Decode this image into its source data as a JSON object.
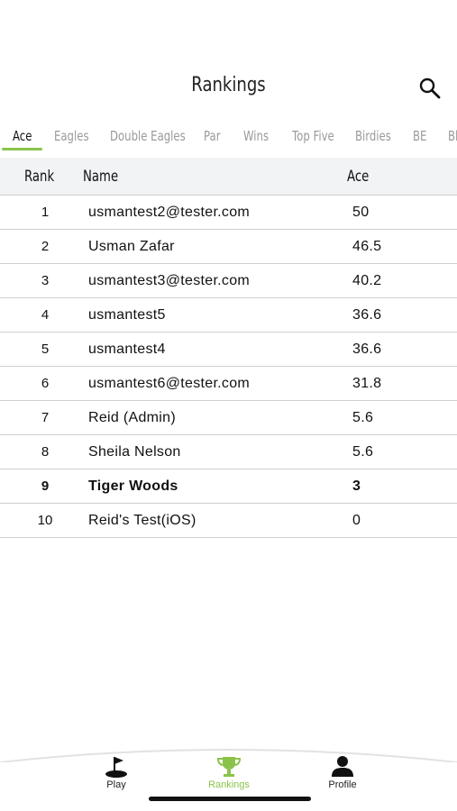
{
  "header": {
    "title": "Rankings",
    "search_icon": "search-icon"
  },
  "tabs": [
    {
      "label": "Ace",
      "active": true
    },
    {
      "label": "Eagles"
    },
    {
      "label": "Double Eagles"
    },
    {
      "label": "Par"
    },
    {
      "label": "Wins"
    },
    {
      "label": "Top Five"
    },
    {
      "label": "Birdies"
    },
    {
      "label": "BE"
    },
    {
      "label": "Bl"
    }
  ],
  "table": {
    "columns": {
      "rank": "Rank",
      "name": "Name",
      "score": "Ace"
    },
    "rows": [
      {
        "rank": "1",
        "name": "usmantest2@tester.com",
        "score": "50"
      },
      {
        "rank": "2",
        "name": "Usman Zafar",
        "score": "46.5"
      },
      {
        "rank": "3",
        "name": "usmantest3@tester.com",
        "score": "40.2"
      },
      {
        "rank": "4",
        "name": "usmantest5",
        "score": "36.6"
      },
      {
        "rank": "5",
        "name": "usmantest4",
        "score": "36.6"
      },
      {
        "rank": "6",
        "name": "usmantest6@tester.com",
        "score": "31.8"
      },
      {
        "rank": "7",
        "name": "Reid (Admin)",
        "score": "5.6"
      },
      {
        "rank": "8",
        "name": "Sheila Nelson",
        "score": "5.6"
      },
      {
        "rank": "9",
        "name": "Tiger Woods",
        "score": "3",
        "highlighted": true
      },
      {
        "rank": "10",
        "name": "Reid's Test(iOS)",
        "score": "0"
      }
    ]
  },
  "bottom_nav": {
    "items": [
      {
        "label": "Play",
        "icon": "golf-flag-icon"
      },
      {
        "label": "Rankings",
        "icon": "trophy-icon",
        "active": true
      },
      {
        "label": "Profile",
        "icon": "person-icon"
      }
    ]
  },
  "colors": {
    "accent": "#8bc34a",
    "header_row_bg": "#f1f3f4",
    "inactive_tab": "#9a9a9a"
  }
}
